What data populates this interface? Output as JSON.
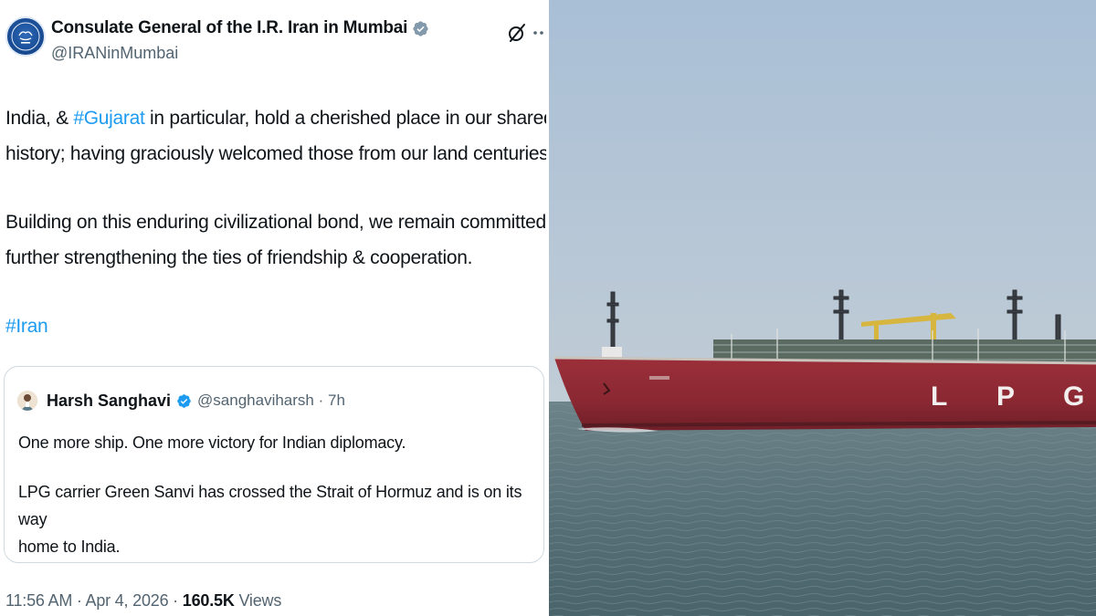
{
  "tweet": {
    "display_name": "Consulate General of the I.R. Iran in Mumbai",
    "handle": "@IRANinMumbai",
    "verified_icon": "verified-badge-icon",
    "para1": {
      "pre": "India, & ",
      "hashtag": "#Gujarat",
      "post_line1": " in particular, hold a cherished place in our shared",
      "line2": "history; having graciously welcomed those from our land centuries ago."
    },
    "para2": {
      "line1": "Building on this enduring civilizational bond, we remain committed to",
      "line2": "further strengthening the ties of friendship & cooperation."
    },
    "hashtag_iran": "#Iran",
    "quote": {
      "name": "Harsh Sanghavi",
      "handle_time": "@sanghaviharsh · 7h",
      "line1": "One more ship. One more victory for Indian diplomacy.",
      "line2a": "LPG carrier Green Sanvi has crossed the Strait of Hormuz and is on its way",
      "line2b": "home to India."
    },
    "meta": {
      "time_date": "11:56 AM · Apr 4, 2026 · ",
      "views_count": "160.5K",
      "views_label": " Views"
    }
  },
  "photo": {
    "hull_text": "L P G",
    "hull_letters": [
      "L",
      "P",
      "G"
    ],
    "colors": {
      "sky": "#b3c4d6",
      "sea": "#4f6b72",
      "hull": "#8f2a33",
      "link": "#1d9bf0",
      "verified": "#829aab"
    }
  }
}
